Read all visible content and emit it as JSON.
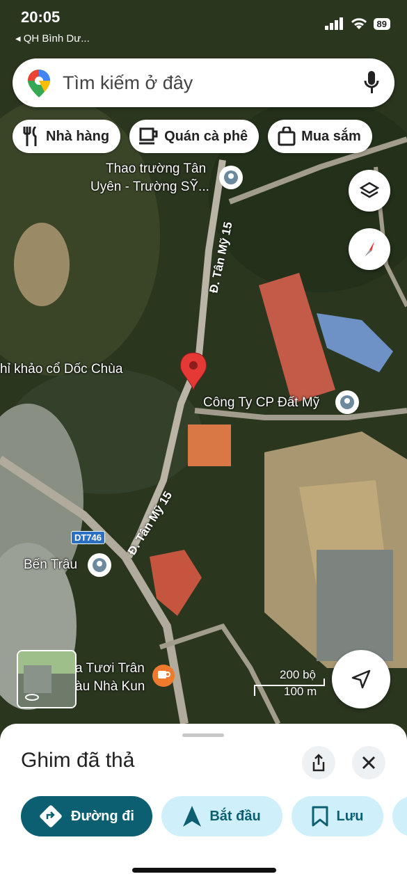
{
  "status_bar": {
    "time": "20:05",
    "back_app": "◂ QH Bình Dư...",
    "battery": "89"
  },
  "search": {
    "placeholder": "Tìm kiếm ở đây"
  },
  "chips": [
    {
      "label": "Nhà hàng",
      "icon": "utensils-icon"
    },
    {
      "label": "Quán cà phê",
      "icon": "coffee-cup-icon"
    },
    {
      "label": "Mua sắm",
      "icon": "shopping-bag-icon"
    }
  ],
  "map": {
    "places": {
      "thao_truong_1": "Thao trường Tân",
      "thao_truong_2": "Uyên - Trường SỸ...",
      "doc_chua": "hỉ khảo cổ Dốc Chùa",
      "cong_ty": "Công Ty CP Đất Mỹ",
      "ben_trau": "Bến Trâu",
      "cafe_1": "a Tươi Trân",
      "cafe_2": "àu Nhà Kun"
    },
    "roads": {
      "upper": "Đ. Tân Mỹ 15",
      "lower": "Đ. Tân Mỹ 15",
      "shield": "DT746"
    },
    "scale": {
      "imperial": "200 bộ",
      "metric": "100 m"
    }
  },
  "sheet": {
    "title": "Ghim đã thả",
    "actions": {
      "directions": "Đường đi",
      "start": "Bắt đầu",
      "save": "Lưu"
    }
  },
  "colors": {
    "accent": "#0b5f70",
    "secondary_bg": "#cff0fb",
    "pin": "#e53935"
  }
}
